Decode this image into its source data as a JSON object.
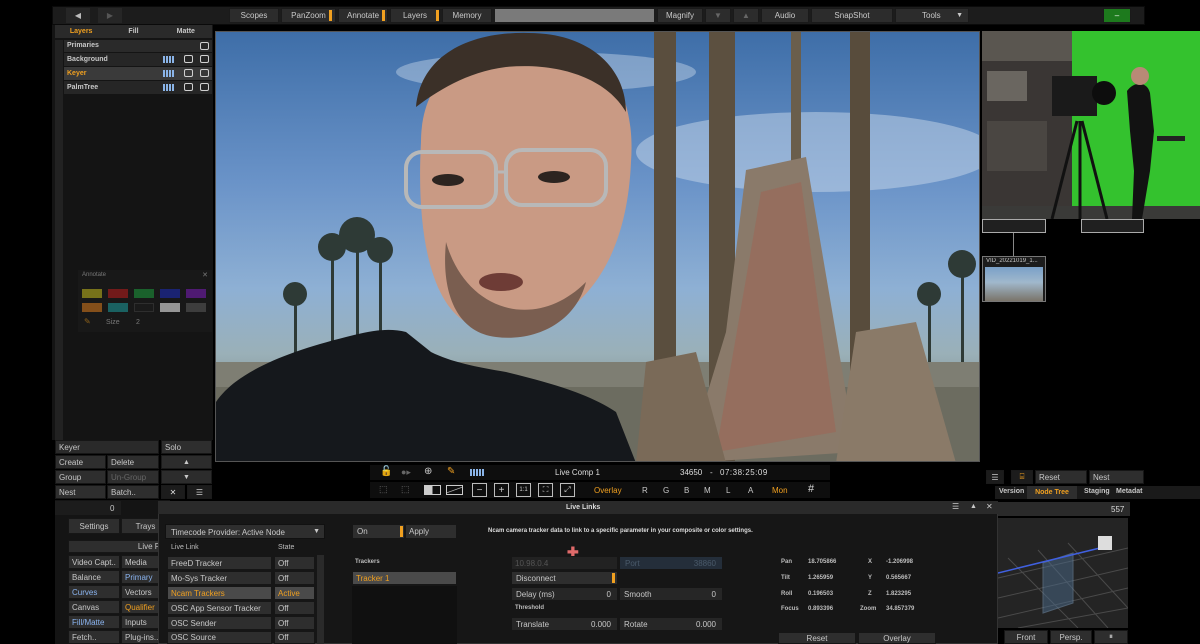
{
  "topbar": {
    "nav": [
      "Scopes",
      "PanZoom",
      "Annotate",
      "Layers",
      "Memory"
    ],
    "magnify": "Magnify",
    "audio": "Audio",
    "snapshot": "SnapShot",
    "tools": "Tools"
  },
  "layers_panel": {
    "tabs": [
      "Layers",
      "Fill",
      "Matte"
    ],
    "items": [
      "Primaries",
      "Background",
      "Keyer",
      "PalmTree"
    ]
  },
  "annotate_panel": {
    "title": "Annotate",
    "size_label": "Size",
    "size_value": "2",
    "colors": [
      "#c8c020",
      "#c02020",
      "#20a040",
      "#2030c0",
      "#8020c0",
      "#e08020",
      "#20a0a0",
      "#202020",
      "#ffffff",
      "#606060"
    ]
  },
  "keyer_panel": {
    "title": "Keyer",
    "solo": "Solo",
    "create": "Create",
    "delete": "Delete",
    "group": "Group",
    "ungroup": "Un-Group",
    "nest": "Nest",
    "batch": "Batch.."
  },
  "viewer": {
    "comp_name": "Live Comp 1",
    "frame": "34650",
    "timecode": "07:38:25:09",
    "overlay": "Overlay",
    "channels": [
      "R",
      "G",
      "B",
      "M",
      "L",
      "A"
    ],
    "mon": "Mon",
    "one_to_one": "1:1"
  },
  "thumbnail": {
    "label": "VID_20221019_1..."
  },
  "node_panel": {
    "reset": "Reset",
    "nest": "Nest",
    "tabs": [
      "Version",
      "Node Tree",
      "Staging",
      "Metadat"
    ],
    "value": "557",
    "front": "Front",
    "persp": "Persp."
  },
  "left_strip": {
    "counter": "0",
    "settings": "Settings",
    "trays": "Trays",
    "live_fx": "Live FX",
    "grid": [
      [
        "Video Capt..",
        "Media"
      ],
      [
        "Balance",
        "Primary"
      ],
      [
        "Curves",
        "Vectors"
      ],
      [
        "Canvas",
        "Qualifier"
      ],
      [
        "Fill/Matte",
        "Inputs"
      ],
      [
        "Fetch..",
        "Plug-ins.."
      ]
    ]
  },
  "live_links": {
    "title": "Live Links",
    "timecode_provider": "Timecode Provider: Active Node",
    "columns": [
      "Live Link",
      "State"
    ],
    "links": [
      {
        "name": "FreeD Tracker",
        "state": "Off"
      },
      {
        "name": "Mo-Sys Tracker",
        "state": "Off"
      },
      {
        "name": "Ncam Trackers",
        "state": "Active"
      },
      {
        "name": "OSC App Sensor Tracker",
        "state": "Off"
      },
      {
        "name": "OSC Sender",
        "state": "Off"
      },
      {
        "name": "OSC Source",
        "state": "Off"
      }
    ],
    "on": "On",
    "apply": "Apply",
    "description": "Ncam camera tracker data to link to a specific parameter in your composite or color settings.",
    "trackers_header": "Trackers",
    "tracker_item": "Tracker 1",
    "ip": "10.98.0.4",
    "port_label": "Port",
    "port": "38860",
    "disconnect": "Disconnect",
    "delay_label": "Delay (ms)",
    "delay": "0",
    "smooth_label": "Smooth",
    "smooth": "0",
    "threshold": "Threshold",
    "translate_label": "Translate",
    "translate": "0.000",
    "rotate_label": "Rotate",
    "rotate": "0.000",
    "readout": [
      {
        "label": "Pan",
        "value": "18.705866",
        "label2": "X",
        "value2": "-1.206998"
      },
      {
        "label": "Tilt",
        "value": "1.265959",
        "label2": "Y",
        "value2": "0.565667"
      },
      {
        "label": "Roll",
        "value": "0.196503",
        "label2": "Z",
        "value2": "1.823295"
      },
      {
        "label": "Focus",
        "value": "0.893396",
        "label2": "Zoom",
        "value2": "34.857379"
      }
    ],
    "reset": "Reset",
    "overlay": "Overlay"
  }
}
